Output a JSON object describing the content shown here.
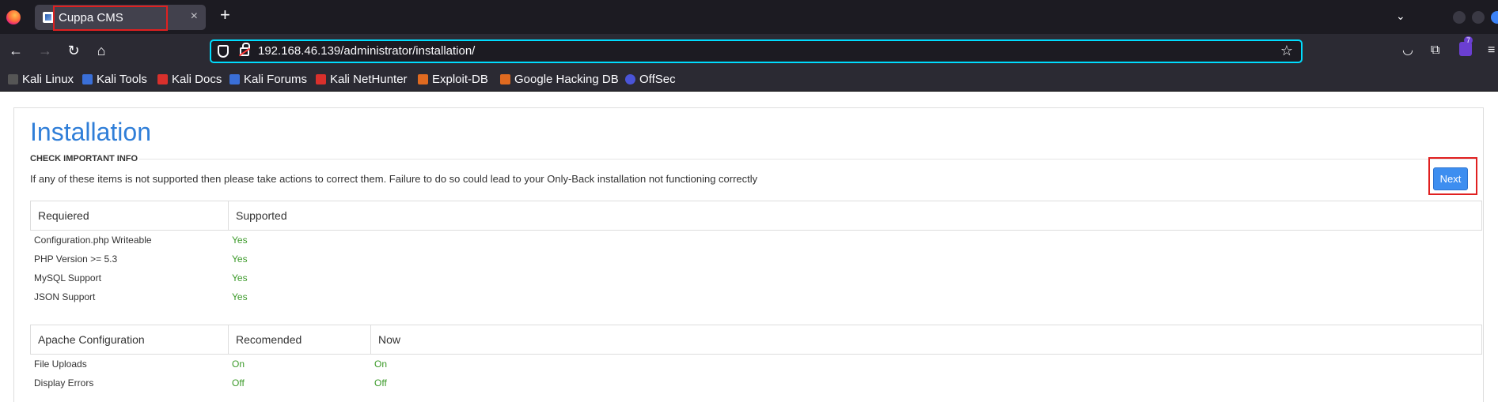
{
  "browser": {
    "tab": {
      "title": "Cuppa CMS",
      "close": "×"
    },
    "new_tab": "+",
    "tab_list": "⌄",
    "nav": {
      "back": "←",
      "forward": "→",
      "reload": "↻",
      "home": "⌂"
    },
    "url": "192.168.46.139/administrator/installation/",
    "star": "☆",
    "extension_badge": "7",
    "toolbar_icons": {
      "pocket": "◡",
      "extensions": "⧉",
      "menu": "≡"
    },
    "bookmarks": [
      {
        "label": "Kali Linux",
        "color": "#2f2f2f"
      },
      {
        "label": "Kali Tools",
        "color": "#3a6fd8"
      },
      {
        "label": "Kali Docs",
        "color": "#d9302c"
      },
      {
        "label": "Kali Forums",
        "color": "#3a6fd8"
      },
      {
        "label": "Kali NetHunter",
        "color": "#d9302c"
      },
      {
        "label": "Exploit-DB",
        "color": "#e06a20"
      },
      {
        "label": "Google Hacking DB",
        "color": "#e06a20"
      },
      {
        "label": "OffSec",
        "color": "#4a54d8"
      }
    ]
  },
  "page": {
    "title": "Installation",
    "section": "CHECK IMPORTANT INFO",
    "description": "If any of these items is not supported then please take actions to correct them. Failure to do so could lead to your Only-Back installation not functioning correctly",
    "next_button": "Next",
    "requirements": {
      "headers": [
        "Requiered",
        "Supported"
      ],
      "rows": [
        [
          "Configuration.php Writeable",
          "Yes"
        ],
        [
          "PHP Version >= 5.3",
          "Yes"
        ],
        [
          "MySQL Support",
          "Yes"
        ],
        [
          "JSON Support",
          "Yes"
        ]
      ]
    },
    "apache": {
      "headers": [
        "Apache Configuration",
        "Recomended",
        "Now"
      ],
      "rows": [
        [
          "File Uploads",
          "On",
          "On"
        ],
        [
          "Display Errors",
          "Off",
          "Off"
        ]
      ]
    }
  },
  "colors": {
    "accent": "#2f7ed8",
    "button": "#3d8ef0",
    "ok": "#3c9a2a",
    "highlight": "#e02020"
  }
}
